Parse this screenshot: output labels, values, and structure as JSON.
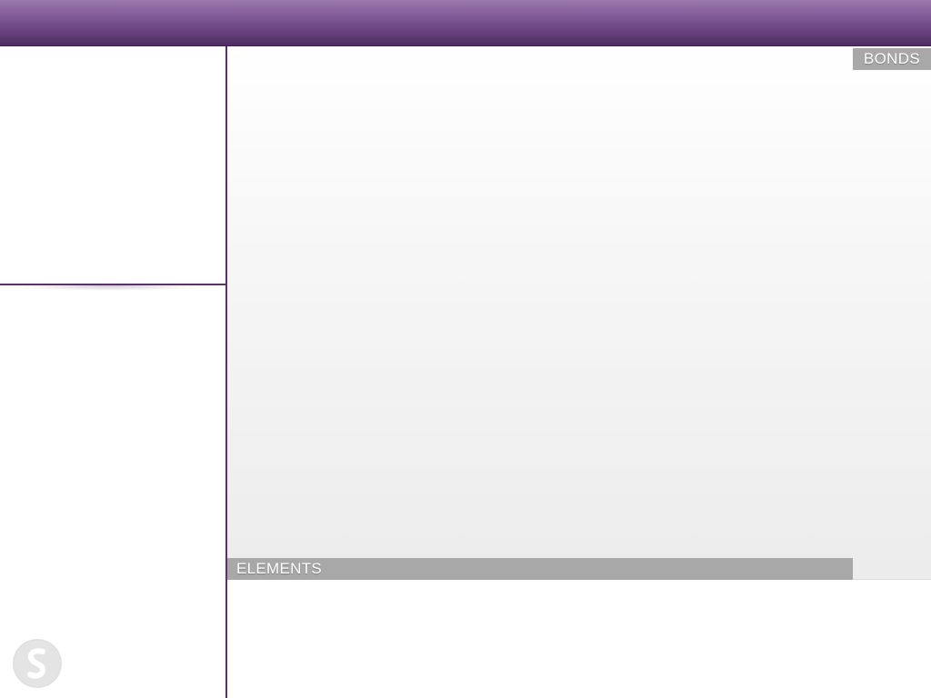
{
  "tabs": {
    "bonds_label": "BONDS",
    "elements_label": "ELEMENTS"
  },
  "logo": {
    "icon": "s-logo-icon"
  },
  "colors": {
    "header_top": "#9a78ad",
    "header_bottom": "#4f2c62",
    "divider": "#5a3268",
    "tab_bg": "#a8a8a8",
    "tab_text": "#ffffff"
  }
}
